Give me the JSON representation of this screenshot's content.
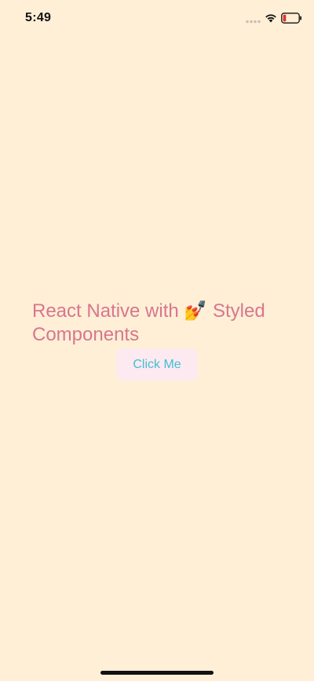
{
  "status_bar": {
    "time": "5:49",
    "icons": [
      "signal-icon",
      "wifi-icon",
      "battery-icon"
    ],
    "battery_level": 0.2
  },
  "main": {
    "heading_part1": "React Native with ",
    "heading_emoji": "💅",
    "heading_part2": " Styled Components",
    "button_label": "Click Me"
  },
  "colors": {
    "background": "#FEEFD6",
    "heading": "#D8768E",
    "button_bg": "#FCEAF0",
    "button_text": "#45BCD4"
  }
}
